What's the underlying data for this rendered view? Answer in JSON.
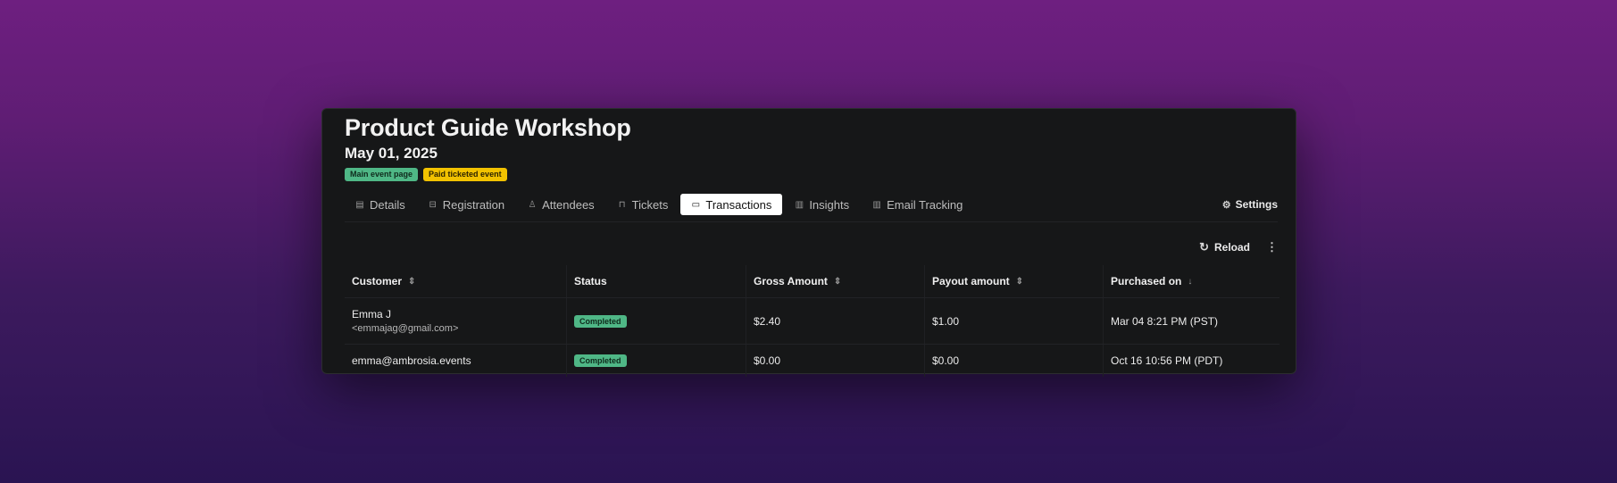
{
  "event": {
    "title": "Product Guide Workshop",
    "date": "May 01, 2025",
    "badges": [
      "Main event page",
      "Paid ticketed event"
    ]
  },
  "tabs": [
    {
      "label": "Details",
      "icon": "document-icon"
    },
    {
      "label": "Registration",
      "icon": "bookmark-icon"
    },
    {
      "label": "Attendees",
      "icon": "person-icon"
    },
    {
      "label": "Tickets",
      "icon": "ticket-icon"
    },
    {
      "label": "Transactions",
      "icon": "money-icon",
      "active": true
    },
    {
      "label": "Insights",
      "icon": "bar-chart-icon"
    },
    {
      "label": "Email Tracking",
      "icon": "bar-chart-icon"
    }
  ],
  "settings_label": "Settings",
  "toolbar": {
    "reload_label": "Reload",
    "more_label": "⋮"
  },
  "table": {
    "columns": [
      "Customer",
      "Status",
      "Gross Amount",
      "Payout amount",
      "Purchased on"
    ],
    "rows": [
      {
        "customer_name": "Emma J",
        "customer_email": "<emmajag@gmail.com>",
        "status": "Completed",
        "gross": "$2.40",
        "payout": "$1.00",
        "purchased_on": "Mar 04 8:21 PM (PST)"
      },
      {
        "customer_name": "emma@ambrosia.events",
        "status": "Completed",
        "gross": "$0.00",
        "payout": "$0.00",
        "purchased_on": "Oct 16 10:56 PM (PDT)"
      }
    ]
  },
  "colors": {
    "accent_green": "#4fb786",
    "accent_yellow": "#f2c200",
    "panel_bg": "#161718"
  }
}
